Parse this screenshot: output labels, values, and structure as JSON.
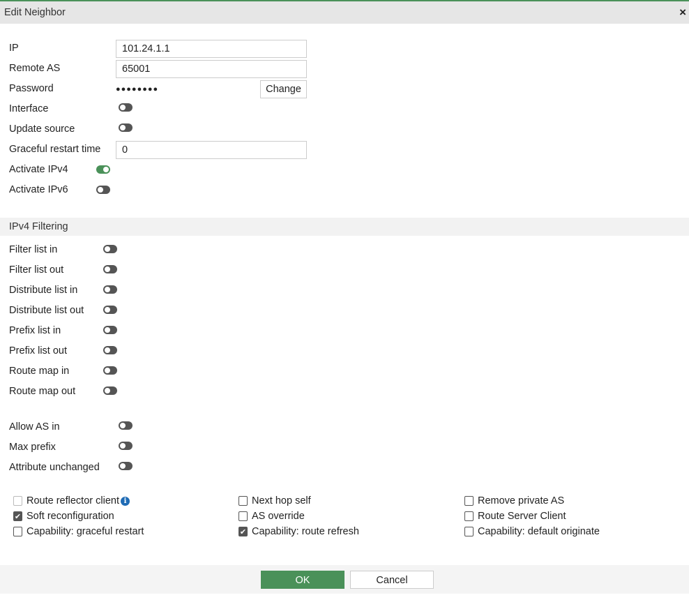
{
  "dialog": {
    "title": "Edit Neighbor",
    "close_icon": "×"
  },
  "general": {
    "ip": {
      "label": "IP",
      "value": "101.24.1.1"
    },
    "remote_as": {
      "label": "Remote AS",
      "value": "65001"
    },
    "password": {
      "label": "Password",
      "value": "●●●●●●●●",
      "change_label": "Change"
    },
    "interface": {
      "label": "Interface",
      "on": false
    },
    "update_source": {
      "label": "Update source",
      "on": false
    },
    "graceful_restart_time": {
      "label": "Graceful restart time",
      "value": "0"
    },
    "activate_ipv4": {
      "label": "Activate IPv4",
      "on": true
    },
    "activate_ipv6": {
      "label": "Activate IPv6",
      "on": false
    }
  },
  "ipv4_filtering": {
    "title": "IPv4 Filtering",
    "items": [
      {
        "label": "Filter list in",
        "on": false
      },
      {
        "label": "Filter list out",
        "on": false
      },
      {
        "label": "Distribute list in",
        "on": false
      },
      {
        "label": "Distribute list out",
        "on": false
      },
      {
        "label": "Prefix list in",
        "on": false
      },
      {
        "label": "Prefix list out",
        "on": false
      },
      {
        "label": "Route map in",
        "on": false
      },
      {
        "label": "Route map out",
        "on": false
      }
    ]
  },
  "advanced": [
    {
      "label": "Allow AS in",
      "on": false
    },
    {
      "label": "Max prefix",
      "on": false
    },
    {
      "label": "Attribute unchanged",
      "on": false
    }
  ],
  "options": [
    {
      "label": "Route reflector client",
      "checked": false
    },
    {
      "label": "Soft reconfiguration",
      "checked": true
    },
    {
      "label": "Capability: graceful restart",
      "checked": false
    },
    {
      "label": "Next hop self",
      "checked": false
    },
    {
      "label": "AS override",
      "checked": false
    },
    {
      "label": "Capability: route refresh",
      "checked": true
    },
    {
      "label": "Remove private AS",
      "checked": false
    },
    {
      "label": "Route Server Client",
      "checked": false
    },
    {
      "label": "Capability: default originate",
      "checked": false
    }
  ],
  "footer": {
    "ok_label": "OK",
    "cancel_label": "Cancel"
  },
  "colors": {
    "accent": "#4a9159",
    "info": "#1f6bb5"
  }
}
